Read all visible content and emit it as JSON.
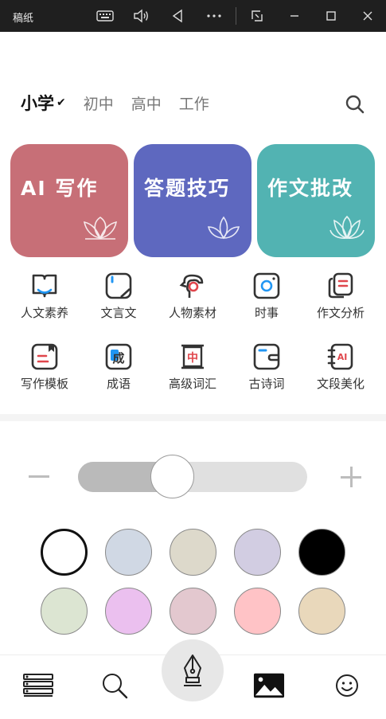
{
  "window": {
    "title": "稿纸",
    "icons": [
      "keyboard-icon",
      "volume-icon",
      "back-triangle-icon",
      "more-icon",
      "screenshot-icon",
      "minimize-icon",
      "maximize-icon",
      "close-icon"
    ]
  },
  "levels": {
    "items": [
      {
        "label": "小学",
        "active": true
      },
      {
        "label": "初中",
        "active": false
      },
      {
        "label": "高中",
        "active": false
      },
      {
        "label": "工作",
        "active": false
      }
    ],
    "check": "✔",
    "search_icon": "search-icon"
  },
  "cards": [
    {
      "label": "AI 写作",
      "color": "#c76f77",
      "icon": "lotus-icon"
    },
    {
      "label": "答题技巧",
      "color": "#5e68bf",
      "icon": "lotus-icon"
    },
    {
      "label": "作文批改",
      "color": "#52b3b2",
      "icon": "lotus-icon"
    }
  ],
  "grid": {
    "row1": [
      {
        "label": "人文素养",
        "icon": "book-icon"
      },
      {
        "label": "文言文",
        "icon": "note-icon"
      },
      {
        "label": "人物素材",
        "icon": "person-icon"
      },
      {
        "label": "时事",
        "icon": "camera-icon"
      },
      {
        "label": "作文分析",
        "icon": "notebook-icon"
      }
    ],
    "row2": [
      {
        "label": "写作模板",
        "icon": "template-icon"
      },
      {
        "label": "成语",
        "icon": "idiom-icon"
      },
      {
        "label": "高级词汇",
        "icon": "vocab-icon"
      },
      {
        "label": "古诗词",
        "icon": "wallet-icon"
      },
      {
        "label": "文段美化",
        "icon": "ai-notebook-icon"
      }
    ],
    "accent_blue": "#2196f3",
    "accent_red": "#e0464c"
  },
  "slider": {
    "value": 0.41,
    "minus_icon": "minus-icon",
    "plus_icon": "plus-icon"
  },
  "colors": {
    "row1": [
      "#ffffff",
      "#d0d8e4",
      "#ddd9cb",
      "#d2cde2",
      "#000000"
    ],
    "row2": [
      "#dce5d2",
      "#ebc0ef",
      "#e3c8cf",
      "#ffc3c6",
      "#e9d8bb"
    ],
    "selected_index": 0
  },
  "bottom_nav": [
    "papers-icon",
    "search-icon",
    "fountain-pen-icon",
    "image-icon",
    "smiley-icon"
  ]
}
